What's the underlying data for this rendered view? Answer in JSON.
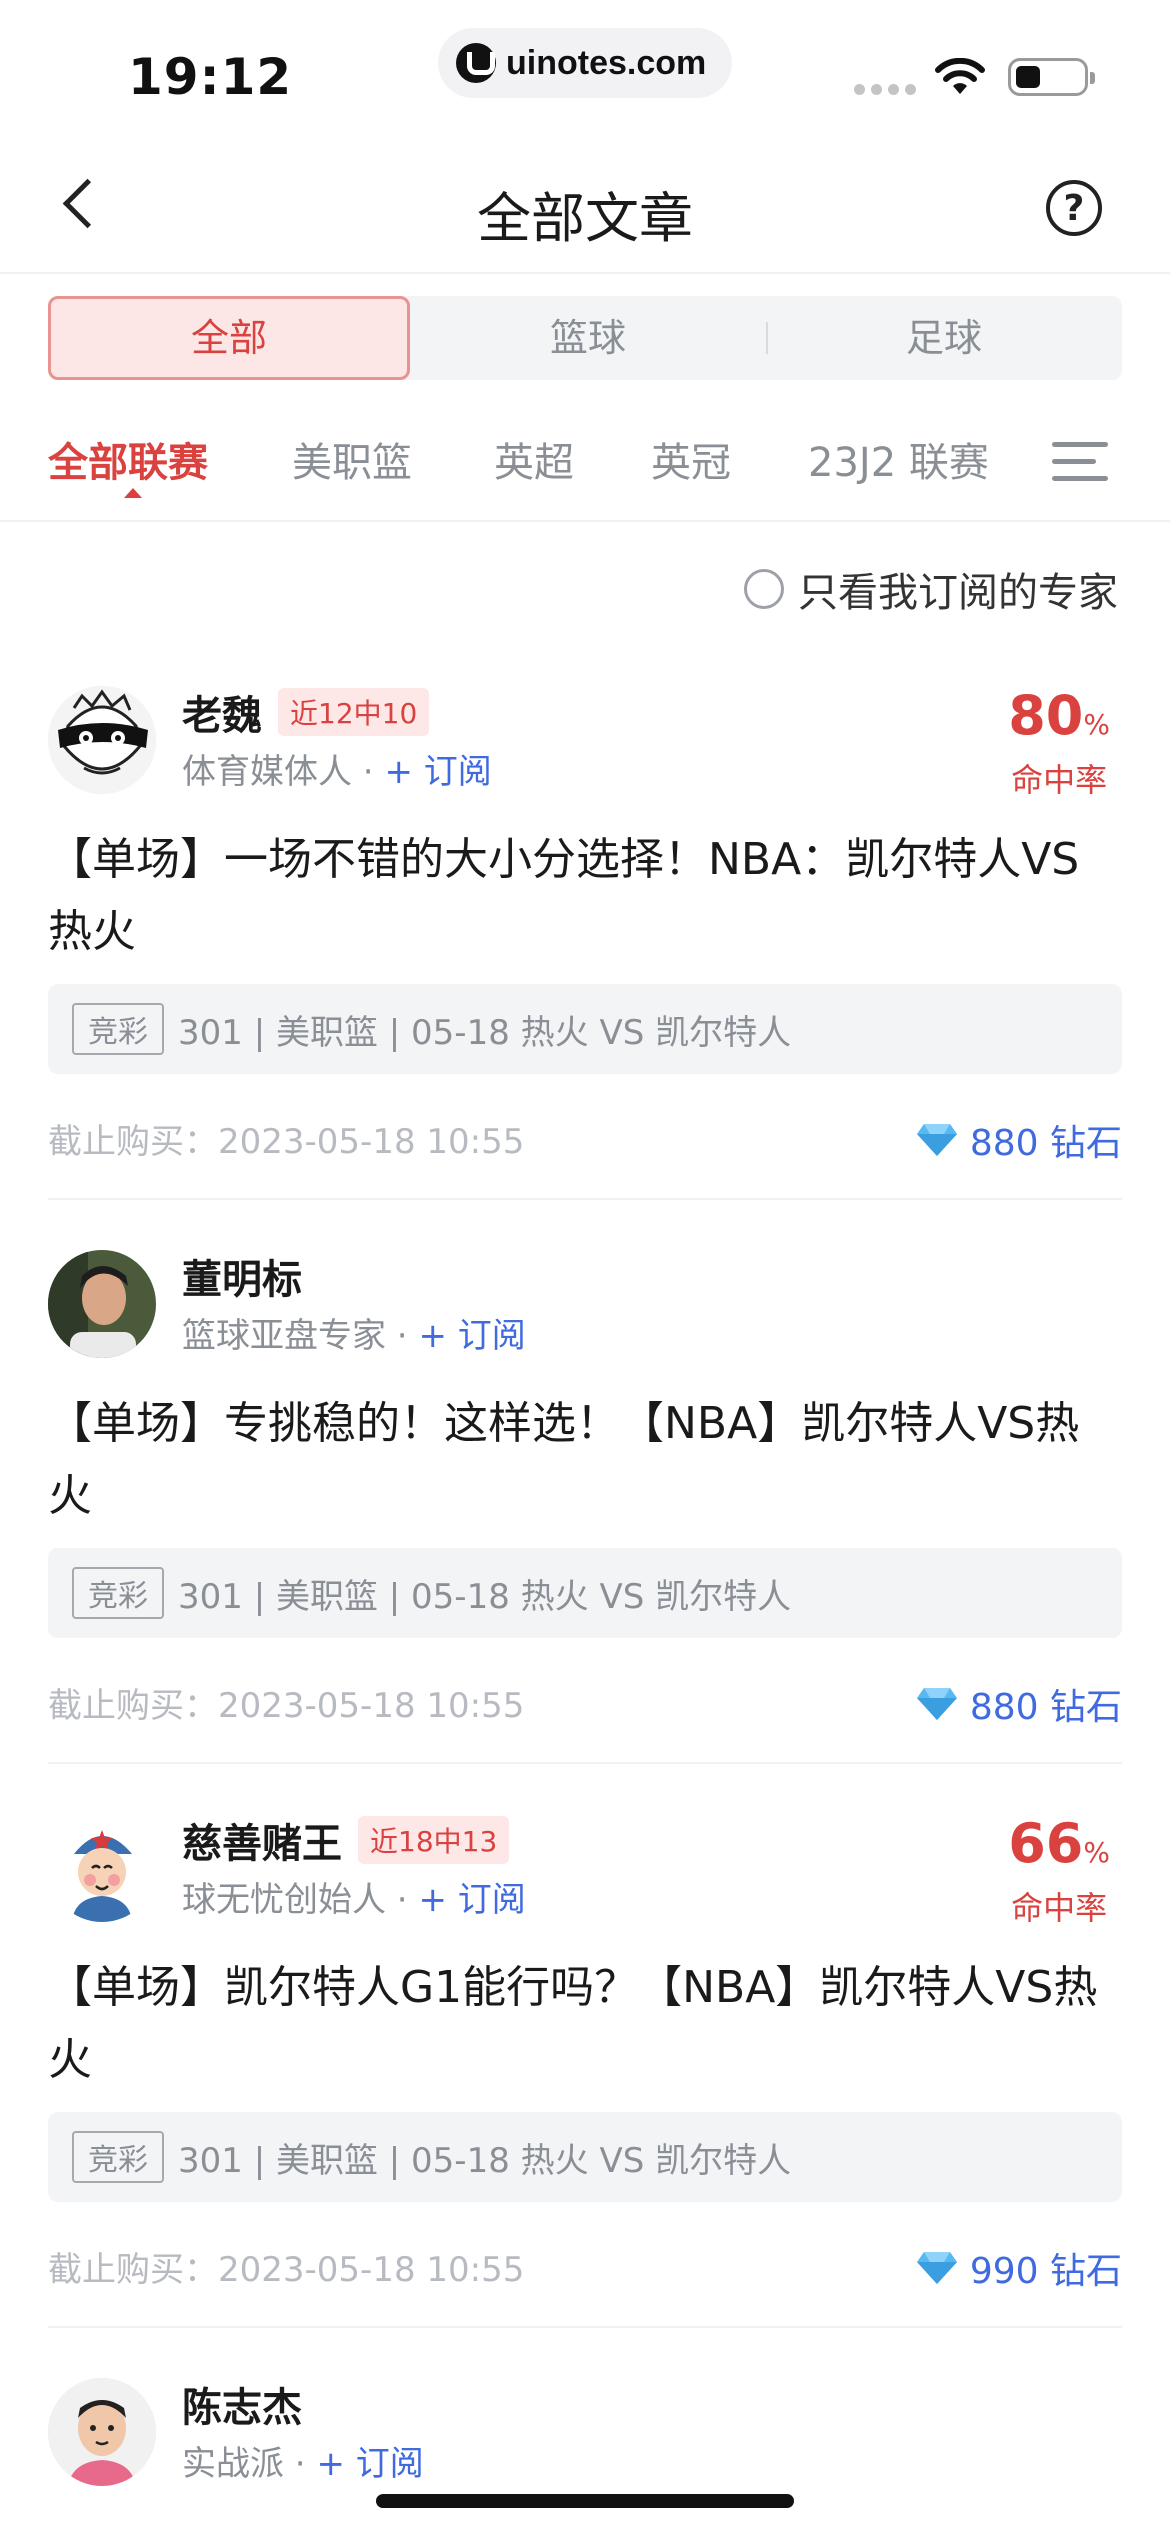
{
  "status_bar": {
    "time": "19:12",
    "url": "uinotes.com"
  },
  "nav": {
    "title": "全部文章",
    "help_icon": "?"
  },
  "segments": [
    "全部",
    "篮球",
    "足球"
  ],
  "league_tabs": [
    "全部联赛",
    "美职篮",
    "英超",
    "英冠",
    "23J2 联赛"
  ],
  "filter": {
    "label": "只看我订阅的专家"
  },
  "colors": {
    "accent_red": "#d9423f",
    "link_blue": "#3f6ae0",
    "muted": "#8a8e95"
  },
  "articles": [
    {
      "author": "老魏",
      "streak": "近12中10",
      "role": "体育媒体人 · ",
      "subscribe": "+ 订阅",
      "hit_rate": "80",
      "hit_pct": "%",
      "hit_label": "命中率",
      "title": "【单场】一场不错的大小分选择！NBA：凯尔特人VS热火",
      "badge": "竞彩",
      "match": "301 | 美职篮 | 05-18 热火 VS 凯尔特人",
      "deadline": "截止购买：2023-05-18 10:55",
      "price": "880 钻石"
    },
    {
      "author": "董明标",
      "role": "篮球亚盘专家 · ",
      "subscribe": "+ 订阅",
      "title": "【单场】专挑稳的！这样选！【NBA】凯尔特人VS热火",
      "badge": "竞彩",
      "match": "301 | 美职篮 | 05-18 热火 VS 凯尔特人",
      "deadline": "截止购买：2023-05-18 10:55",
      "price": "880 钻石"
    },
    {
      "author": "慈善赌王",
      "streak": "近18中13",
      "role": "球无忧创始人 · ",
      "subscribe": "+ 订阅",
      "hit_rate": "66",
      "hit_pct": "%",
      "hit_label": "命中率",
      "title": "【单场】凯尔特人G1能行吗？【NBA】凯尔特人VS热火",
      "badge": "竞彩",
      "match": "301 | 美职篮 | 05-18 热火 VS 凯尔特人",
      "deadline": "截止购买：2023-05-18 10:55",
      "price": "990 钻石"
    },
    {
      "author": "陈志杰",
      "role": "实战派 · ",
      "subscribe": "+ 订阅"
    }
  ]
}
